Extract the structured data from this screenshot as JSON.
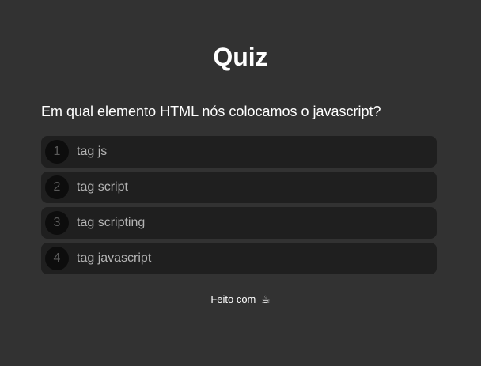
{
  "header": {
    "title": "Quiz"
  },
  "quiz": {
    "question": "Em qual elemento HTML nós colocamos o javascript?",
    "answers": [
      {
        "number": "1",
        "label": "tag js"
      },
      {
        "number": "2",
        "label": "tag script"
      },
      {
        "number": "3",
        "label": "tag scripting"
      },
      {
        "number": "4",
        "label": "tag javascript"
      }
    ]
  },
  "footer": {
    "text": "Feito com",
    "icon": "coffee-icon",
    "icon_glyph": "☕"
  }
}
